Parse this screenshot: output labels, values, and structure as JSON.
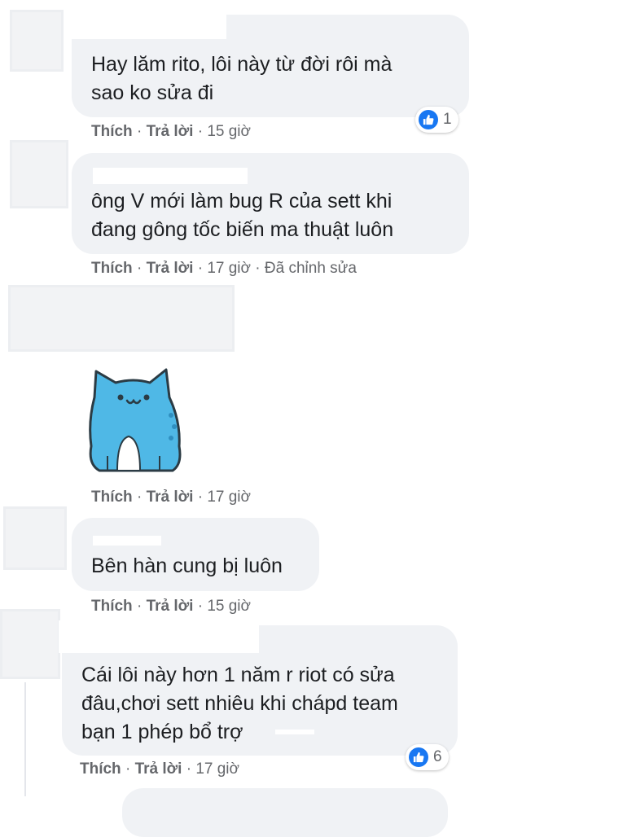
{
  "colors": {
    "bubble_bg": "#f0f2f5",
    "meta_text": "#65676b",
    "like_blue": "#1877f2",
    "sticker_blue": "#4fb8e6"
  },
  "comments": [
    {
      "text": "Hay lăm rito, lôi này từ đời rôi mà\nsao ko sửa đi",
      "like_label": "Thích",
      "reply_label": "Trả lời",
      "time": "15 giờ",
      "reaction_count": "1",
      "reaction_icon": "like-icon"
    },
    {
      "text": "ông V mới làm bug R của sett khi\nđang gông tốc biến ma thuật luôn",
      "like_label": "Thích",
      "reply_label": "Trả lời",
      "time": "17 giờ",
      "edited": "Đã chỉnh sửa"
    },
    {
      "sticker": "blue-cat-sticker",
      "like_label": "Thích",
      "reply_label": "Trả lời",
      "time": "17 giờ"
    },
    {
      "text": "Bên hàn cung bị luôn",
      "like_label": "Thích",
      "reply_label": "Trả lời",
      "time": "15 giờ"
    },
    {
      "text": "Cái lôi này hơn 1 năm r riot có sửa\nđâu,chơi sett nhiêu khi chápd team\nbạn 1 phép bổ trợ",
      "like_label": "Thích",
      "reply_label": "Trả lời",
      "time": "17 giờ",
      "reaction_count": "6",
      "reaction_icon": "like-icon"
    }
  ]
}
